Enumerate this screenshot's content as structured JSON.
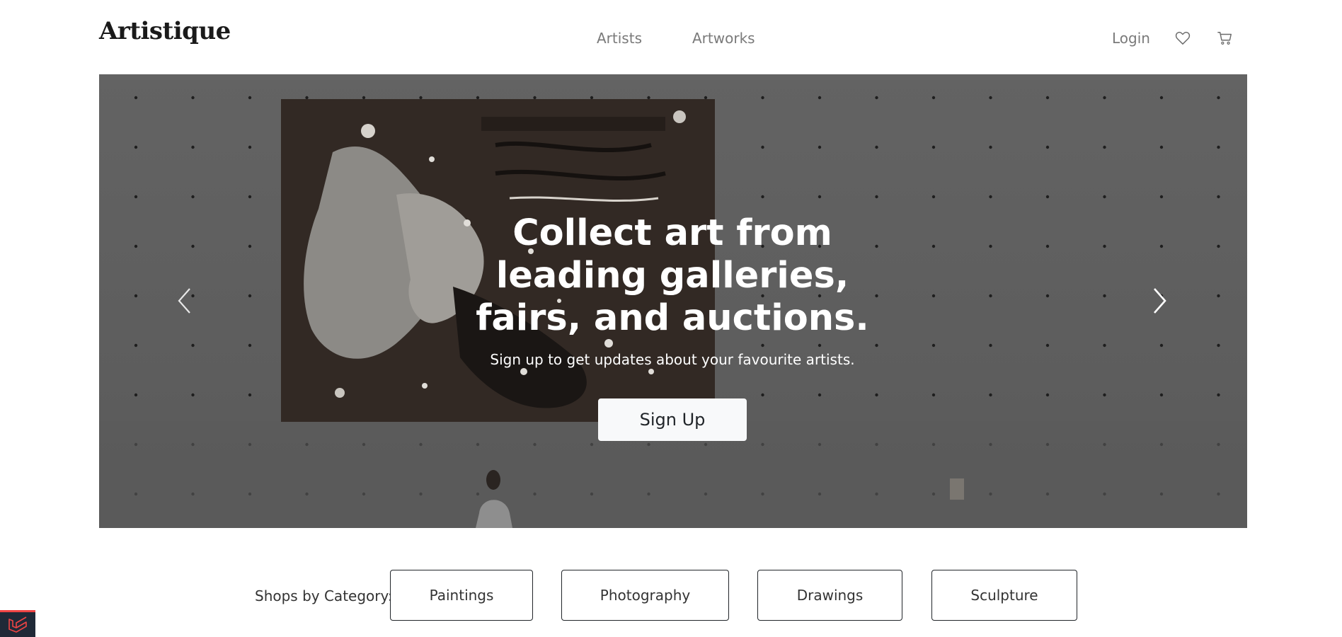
{
  "header": {
    "logo": "Artistique",
    "nav": {
      "artists": "Artists",
      "artworks": "Artworks"
    },
    "login": "Login",
    "icons": {
      "wishlist": "heart-icon",
      "cart": "cart-icon"
    }
  },
  "hero": {
    "title": "Collect art from leading galleries, fairs, and auctions.",
    "subtitle": "Sign up to get updates about your favourite artists.",
    "cta_label": "Sign Up",
    "prev_icon": "chevron-left-icon",
    "next_icon": "chevron-right-icon"
  },
  "categories": {
    "label": "Shops by Category:",
    "items": [
      "Paintings",
      "Photography",
      "Drawings",
      "Sculpture"
    ]
  },
  "colors": {
    "overlay": "#5f5f5f",
    "button_light": "#f8f9fa",
    "text_dark": "#212529",
    "nav_gray": "#7a7a7a",
    "badge_red": "#ef4444"
  }
}
